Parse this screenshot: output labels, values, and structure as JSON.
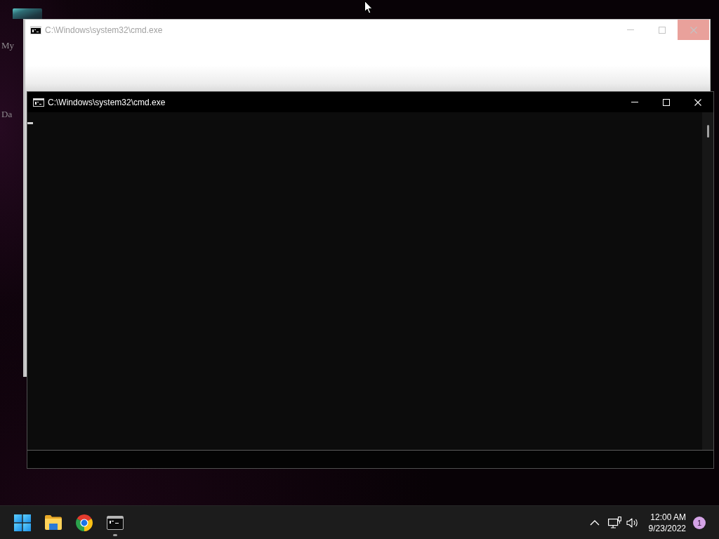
{
  "desktop": {
    "icons": [
      {
        "label": "My",
        "tile": true
      },
      {
        "label": "Da",
        "tile": false
      }
    ]
  },
  "windows": [
    {
      "kind": "blank",
      "title": "C:\\Windows\\system32\\cmd.exe",
      "active": false,
      "close_hover": true
    },
    {
      "kind": "console",
      "title": "C:\\Windows\\system32\\cmd.exe",
      "active": true,
      "close_hover": false
    }
  ],
  "taskbar": {
    "apps": [
      {
        "kind": "start",
        "running": false
      },
      {
        "kind": "folder",
        "running": false
      },
      {
        "kind": "browser",
        "running": false
      },
      {
        "kind": "terminal",
        "running": true
      }
    ],
    "tray": {
      "time": "12:00 AM",
      "date": "9/23/2022",
      "notifications": "1"
    }
  }
}
